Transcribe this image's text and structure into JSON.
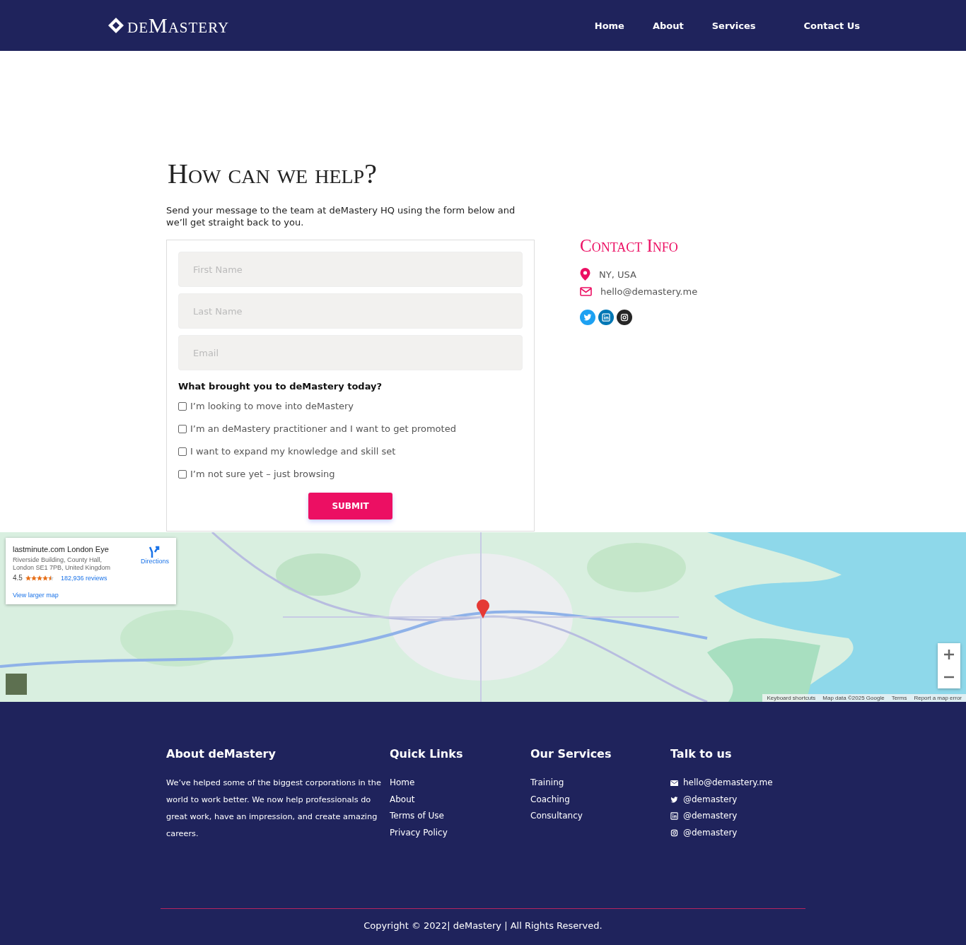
{
  "header": {
    "logo": "deMastery",
    "nav": [
      {
        "label": "Home"
      },
      {
        "label": "About"
      },
      {
        "label": "Services"
      },
      {
        "label": "Contact Us"
      }
    ]
  },
  "intro": {
    "title": "How can we help?",
    "text": "Send your message to the team at deMastery HQ using the form below and we’ll get straight back to you."
  },
  "form": {
    "fields": [
      {
        "placeholder": "First Name"
      },
      {
        "placeholder": "Last Name"
      },
      {
        "placeholder": "Email"
      }
    ],
    "question": "What brought you to deMastery today?",
    "options": [
      {
        "label": "I’m looking to move into deMastery",
        "checked": false
      },
      {
        "label": "I’m an deMastery practitioner and I want to get promoted",
        "checked": false
      },
      {
        "label": "I want to expand my knowledge and skill set",
        "checked": false
      },
      {
        "label": "I’m not sure yet – just browsing",
        "checked": false
      }
    ],
    "submit": "SUBMIT"
  },
  "contact_info": {
    "title": "Contact Info",
    "items": [
      {
        "kind": "location",
        "text": "NY, USA"
      },
      {
        "kind": "email",
        "text": "hello@demastery.me"
      }
    ],
    "social": [
      {
        "kind": "twitter",
        "color": "#1da1f2"
      },
      {
        "kind": "linkedin",
        "color": "#0077b5"
      },
      {
        "kind": "instagram",
        "color": "#262626"
      }
    ]
  },
  "map": {
    "kind": "picture",
    "card": {
      "title": "lastminute.com London Eye",
      "address": "Riverside Building, County Hall, London SE1 7PB, United Kingdom",
      "rating": "4.5",
      "stars": 4.5,
      "reviews": "182,936 reviews",
      "directions": "Directions",
      "larger": "View larger map"
    },
    "zoom": [
      {
        "kind": "in"
      },
      {
        "kind": "out"
      }
    ],
    "attribution": [
      "Keyboard shortcuts",
      "Map data ©2025 Google",
      "Terms",
      "Report a map error"
    ]
  },
  "footer": {
    "about": {
      "title": "About deMastery",
      "text": "We’ve helped some of the biggest corporations in the world to work better. We now help professionals do great work, have an impression, and create amazing careers."
    },
    "quick_links": {
      "title": "Quick Links",
      "items": [
        "Home",
        "About",
        "Terms of Use",
        "Privacy Policy"
      ]
    },
    "services": {
      "title": "Our Services",
      "items": [
        "Training",
        "Coaching",
        "Consultancy"
      ]
    },
    "talk": {
      "title": "Talk to us",
      "items": [
        {
          "kind": "email",
          "text": "hello@demastery.me"
        },
        {
          "kind": "twitter",
          "text": "@demastery"
        },
        {
          "kind": "linkedin",
          "text": "@demastery"
        },
        {
          "kind": "instagram",
          "text": "@demastery"
        }
      ]
    },
    "copyright": "Copyright © 2022| deMastery | All Rights Reserved."
  }
}
